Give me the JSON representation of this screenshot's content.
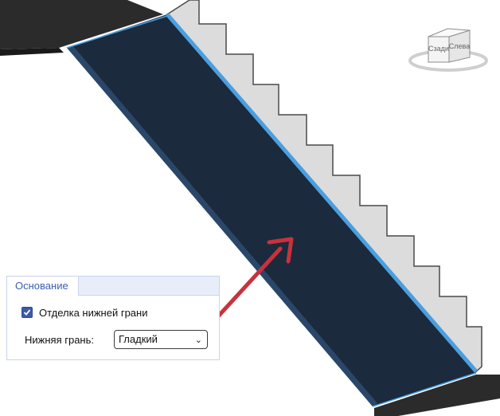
{
  "viewcube": {
    "faces": [
      "Сзади",
      "Слева"
    ]
  },
  "panel": {
    "tab_label": "Основание",
    "checkbox_label": "Отделка нижней грани",
    "checkbox_checked": true,
    "select_label": "Нижняя грань:",
    "select_value": "Гладкий"
  },
  "colors": {
    "stair_slab": "#1b2a3c",
    "selection_edge": "#4a9fe0",
    "arrow": "#c8323c",
    "checkbox": "#3d5aa8"
  }
}
